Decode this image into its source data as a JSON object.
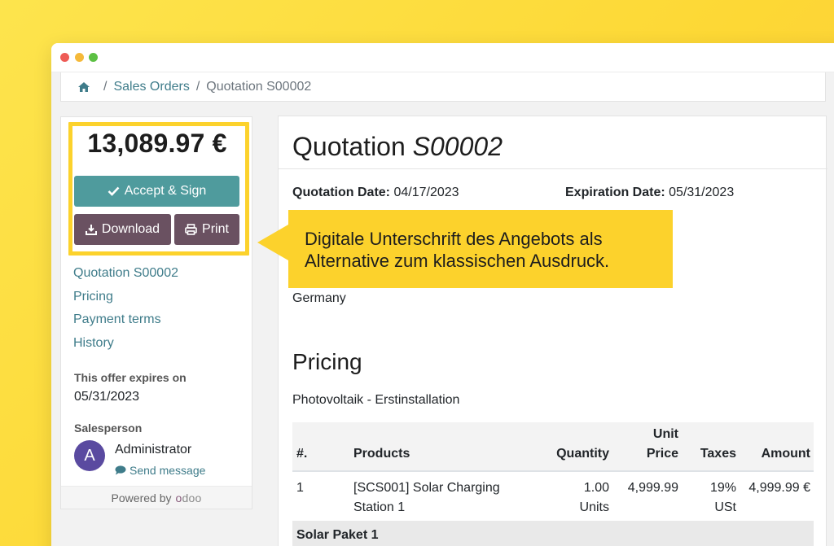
{
  "breadcrumb": {
    "home_icon": "home-icon",
    "separator": "/",
    "items": [
      "Sales Orders",
      "Quotation S00002"
    ]
  },
  "sidebar": {
    "total": "13,089.97 €",
    "accept_label": "Accept & Sign",
    "download_label": "Download",
    "print_label": "Print",
    "nav": [
      "Quotation S00002",
      "Pricing",
      "Payment terms",
      "History"
    ],
    "expires_label": "This offer expires on",
    "expires_date": "05/31/2023",
    "salesperson_label": "Salesperson",
    "avatar_letter": "A",
    "salesperson_name": "Administrator",
    "send_message": "Send message",
    "powered_by": "Powered by",
    "logo_text": "odoo"
  },
  "main": {
    "title_prefix": "Quotation",
    "title_ref": "S00002",
    "quotation_date_label": "Quotation Date:",
    "quotation_date": "04/17/2023",
    "expiration_date_label": "Expiration Date:",
    "expiration_date": "05/31/2023",
    "country": "Germany",
    "pricing_title": "Pricing",
    "pricing_subtitle": "Photovoltaik - Erstinstallation"
  },
  "callout": {
    "line1": "Digitale Unterschrift des Angebots als",
    "line2": "Alternative zum klassischen Ausdruck."
  },
  "table": {
    "headers": {
      "num": "#.",
      "products": "Products",
      "quantity": "Quantity",
      "unit_price_1": "Unit",
      "unit_price_2": "Price",
      "taxes": "Taxes",
      "amount": "Amount"
    },
    "rows": [
      {
        "num": "1",
        "product_line1": "[SCS001] Solar Charging",
        "product_line2": "Station 1",
        "quantity_line1": "1.00",
        "quantity_line2": "Units",
        "unit_price": "4,999.99",
        "taxes_line1": "19%",
        "taxes_line2": "USt",
        "amount": "4,999.99 €"
      }
    ],
    "section": "Solar Paket 1"
  },
  "colors": {
    "accent_yellow": "#fcd22c",
    "accept_button": "#4f9b9d",
    "secondary_button": "#6a5161",
    "link": "#3f7c8a",
    "avatar": "#5a4aa0"
  }
}
